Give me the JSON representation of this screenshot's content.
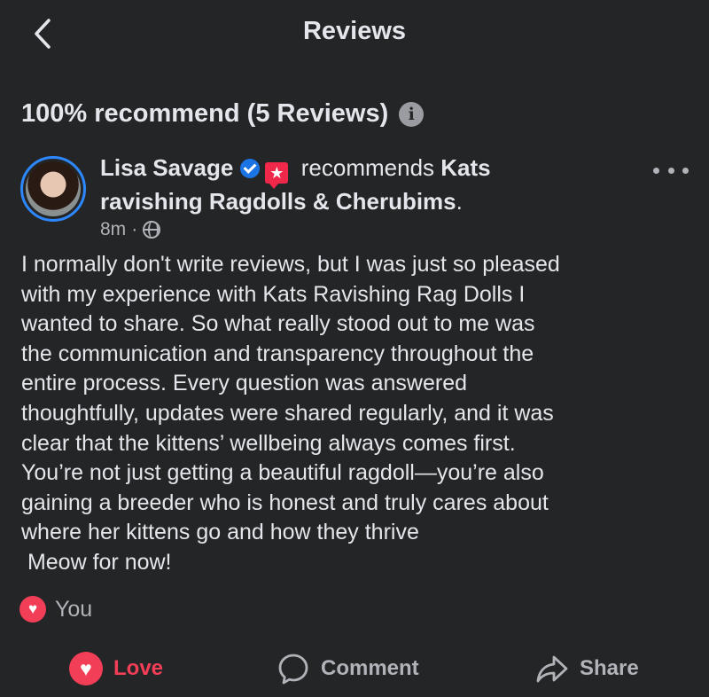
{
  "header": {
    "title": "Reviews",
    "back_icon": "chevron-left-icon"
  },
  "summary": {
    "text": "100% recommend (5 Reviews)",
    "info_icon": "i"
  },
  "review": {
    "author": "Lisa Savage",
    "action_text": "recommends",
    "page_name_part1": "Kats",
    "page_name_part2": "ravishing Ragdolls & Cherubims",
    "page_name_suffix": ".",
    "timestamp": "8m",
    "separator": "·",
    "body_lines": [
      "I normally don't write reviews, but I was just so pleased",
      "with my experience with Kats Ravishing Rag Dolls I",
      "wanted to share. So what really stood out to me was",
      "the communication and transparency throughout the",
      "entire process. Every question was answered",
      "thoughtfully, updates were shared regularly, and it was",
      "clear that the kittens’ wellbeing always comes first.",
      "You’re not just getting a beautiful ragdoll—you’re also",
      "gaining a breeder who is honest and truly cares about",
      "where her kittens go and how they thrive",
      " Meow for now!"
    ],
    "reaction_by": "You",
    "reaction_icon": "heart-icon"
  },
  "actions": {
    "love_label": "Love",
    "comment_label": "Comment",
    "share_label": "Share"
  },
  "colors": {
    "background": "#242526",
    "text_primary": "#e4e6eb",
    "text_secondary": "#b0b3b8",
    "love": "#f33e58",
    "verified": "#1b74e4",
    "recommend_badge": "#f02849",
    "avatar_ring": "#2d88ff"
  }
}
